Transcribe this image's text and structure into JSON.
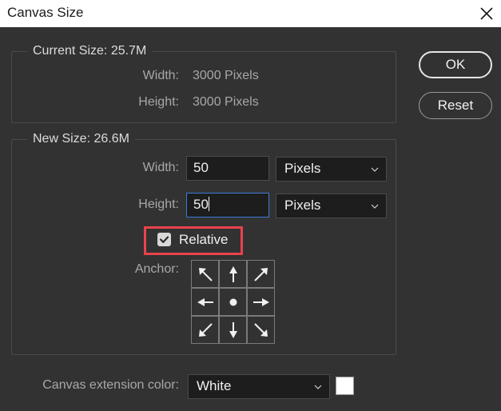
{
  "window": {
    "title": "Canvas Size",
    "close_icon": "close-icon"
  },
  "current_size": {
    "legend": "Current Size: 25.7M",
    "width_label": "Width:",
    "width_value": "3000 Pixels",
    "height_label": "Height:",
    "height_value": "3000 Pixels"
  },
  "new_size": {
    "legend": "New Size: 26.6M",
    "width_label": "Width:",
    "width_value": "50",
    "width_unit": "Pixels",
    "height_label": "Height:",
    "height_value": "50",
    "height_unit": "Pixels",
    "relative_label": "Relative",
    "relative_checked": true,
    "anchor_label": "Anchor:",
    "anchor_cells": [
      "arrow-up-left-icon",
      "arrow-up-icon",
      "arrow-up-right-icon",
      "arrow-left-icon",
      "anchor-center-dot-icon",
      "arrow-right-icon",
      "arrow-down-left-icon",
      "arrow-down-icon",
      "arrow-down-right-icon"
    ]
  },
  "extension": {
    "label": "Canvas extension color:",
    "value": "White",
    "swatch_color": "#ffffff"
  },
  "buttons": {
    "ok_label": "OK",
    "reset_label": "Reset"
  },
  "colors": {
    "background": "#323232",
    "highlight": "#e8434c",
    "focus": "#3d7ad6"
  }
}
